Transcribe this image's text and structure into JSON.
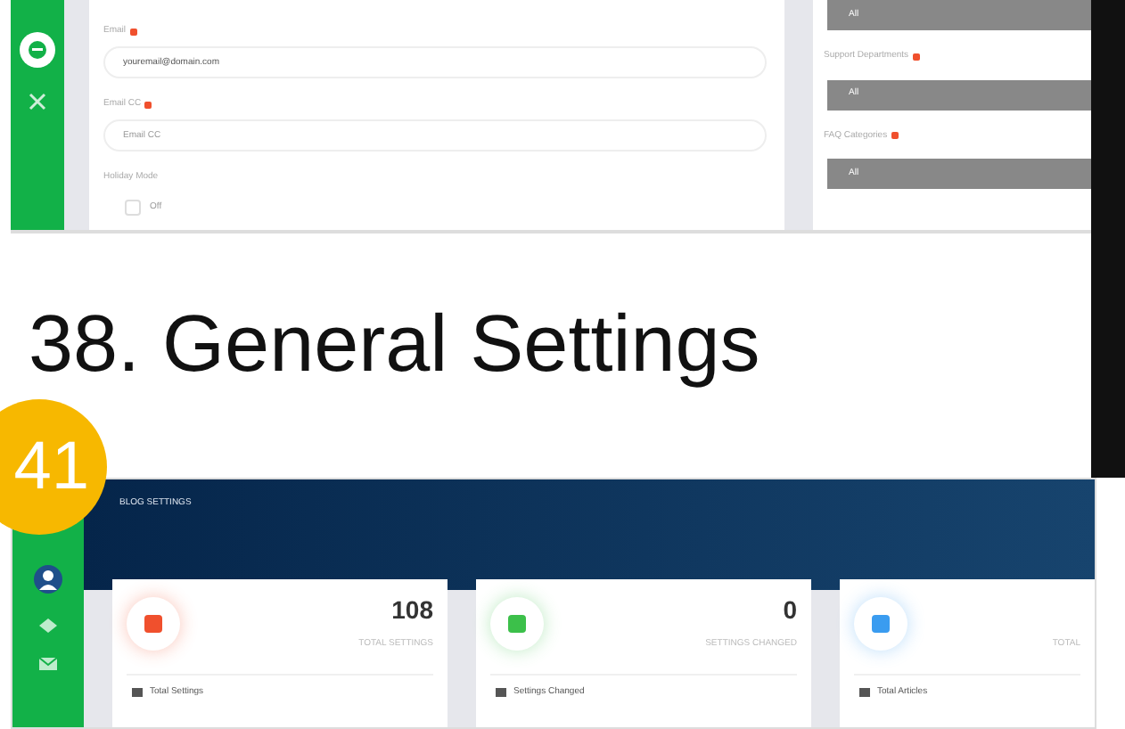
{
  "top_screenshot": {
    "form": {
      "fields": [
        {
          "label": "Email",
          "required": true,
          "value": "youremail@domain.com"
        },
        {
          "label": "Email CC",
          "required": true,
          "placeholder": "Email CC"
        }
      ],
      "holiday_mode": {
        "label": "Holiday Mode",
        "options": [
          {
            "label": "Off",
            "checked": false
          }
        ]
      }
    },
    "side_panel": {
      "selects": [
        {
          "value": "All"
        },
        {
          "label": "Support Departments",
          "required": true,
          "value": "All"
        },
        {
          "label": "FAQ Categories",
          "required": true,
          "value": "All"
        }
      ]
    }
  },
  "heading": "38. General Settings",
  "badge": "41",
  "bottom_screenshot": {
    "header_title": "BLOG SETTINGS",
    "stats": [
      {
        "value": "108",
        "label": "TOTAL SETTINGS",
        "footer": "Total Settings",
        "color": "#f0502d"
      },
      {
        "value": "0",
        "label": "SETTINGS CHANGED",
        "footer": "Settings Changed",
        "color": "#3cc04a"
      },
      {
        "label": "TOTAL",
        "footer": "Total Articles",
        "color": "#3a9cf0"
      }
    ]
  }
}
